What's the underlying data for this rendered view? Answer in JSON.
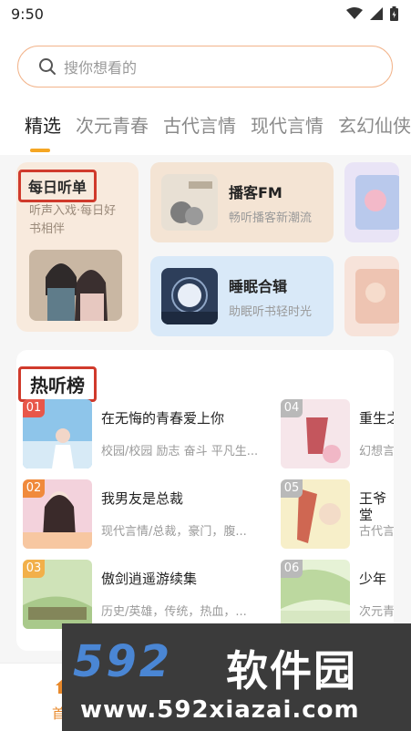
{
  "status": {
    "time": "9:50"
  },
  "search": {
    "placeholder": "搜你想看的"
  },
  "tabs": [
    {
      "label": "精选",
      "active": true
    },
    {
      "label": "次元青春"
    },
    {
      "label": "古代言情"
    },
    {
      "label": "现代言情"
    },
    {
      "label": "玄幻仙侠"
    }
  ],
  "daily": {
    "title": "每日听单",
    "subtitle": "听声入戏·每日好书相伴"
  },
  "podcast": {
    "name": "播客FM",
    "desc": "畅听播客新潮流"
  },
  "sleep": {
    "name": "睡眠合辑",
    "desc": "助眠听书轻时光"
  },
  "hot": {
    "title": "热听榜",
    "items": [
      {
        "rank": "01",
        "title": "在无悔的青春爱上你",
        "tags": "校园/校园 励志 奋斗 平凡生..."
      },
      {
        "rank": "02",
        "title": "我男友是总裁",
        "tags": "现代言情/总裁，豪门，腹..."
      },
      {
        "rank": "03",
        "title": "傲剑逍遥游续集",
        "tags": "历史/英雄，传统，热血，..."
      },
      {
        "rank": "04",
        "title": "重生之",
        "tags": "幻想言"
      },
      {
        "rank": "05",
        "title": "王爷",
        "tags": "古代言"
      },
      {
        "rank": "06",
        "title": "少年",
        "tags": "次元青"
      }
    ]
  },
  "hot_item5_line2": "堂",
  "bottomnav": {
    "home_label": "首"
  },
  "watermark": {
    "logo": "592",
    "cn": "软件园",
    "url": "www.592xiazai.com"
  },
  "colors": {
    "accent": "#f5a623",
    "highlight_border": "#d03a2c",
    "search_border": "#f2b48b"
  }
}
